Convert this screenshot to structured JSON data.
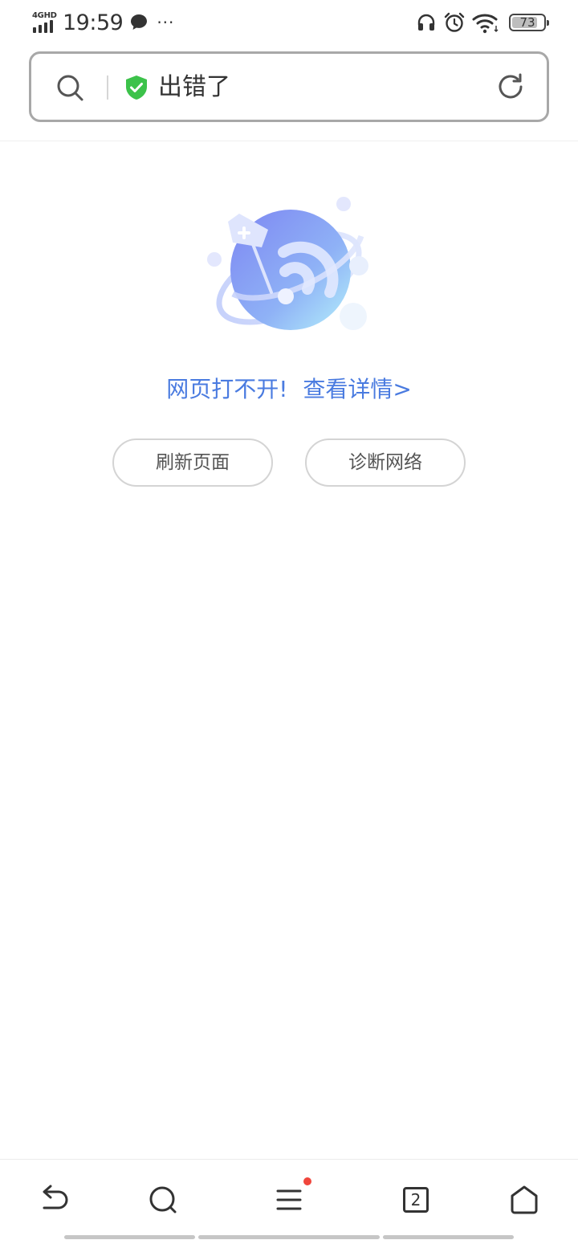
{
  "status_bar": {
    "network": "4GHD",
    "time": "19:59",
    "more": "···",
    "battery_percent": "73"
  },
  "address_bar": {
    "title": "出错了"
  },
  "error": {
    "message": "网页打不开!",
    "details_link": "查看详情>",
    "refresh_button": "刷新页面",
    "diagnose_button": "诊断网络"
  },
  "bottom_nav": {
    "tab_count": "2"
  },
  "colors": {
    "accent_link": "#4a7be0",
    "shield_green": "#3cc24a",
    "notification_dot": "#f0463c"
  }
}
